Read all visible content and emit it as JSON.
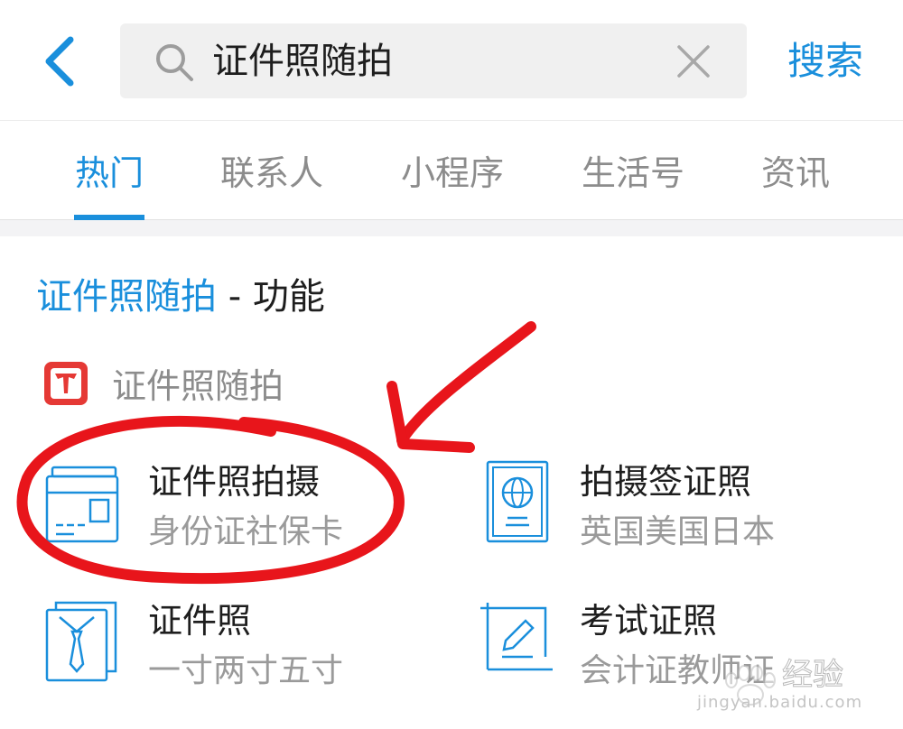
{
  "search": {
    "query": "证件照随拍",
    "submit_label": "搜索"
  },
  "tabs": [
    {
      "label": "热门",
      "active": true
    },
    {
      "label": "联系人",
      "active": false
    },
    {
      "label": "小程序",
      "active": false
    },
    {
      "label": "生活号",
      "active": false
    },
    {
      "label": "资讯",
      "active": false
    }
  ],
  "section": {
    "keyword": "证件照随拍",
    "suffix": " - 功能"
  },
  "app": {
    "name": "证件照随拍",
    "logo_icon": "tie-logo-icon"
  },
  "services": [
    {
      "title": "证件照拍摄",
      "subtitle": "身份证社保卡",
      "icon": "id-card-icon"
    },
    {
      "title": "拍摄签证照",
      "subtitle": "英国美国日本",
      "icon": "passport-icon"
    },
    {
      "title": "证件照",
      "subtitle": "一寸两寸五寸",
      "icon": "suit-tie-icon"
    },
    {
      "title": "考试证照",
      "subtitle": "会计证教师证",
      "icon": "edit-certificate-icon"
    }
  ],
  "watermark": {
    "text": "经验",
    "url": "jingyan.baidu.com"
  },
  "colors": {
    "accent": "#1a8fdc",
    "annotation": "#e8151b",
    "logo": "#e53935"
  }
}
